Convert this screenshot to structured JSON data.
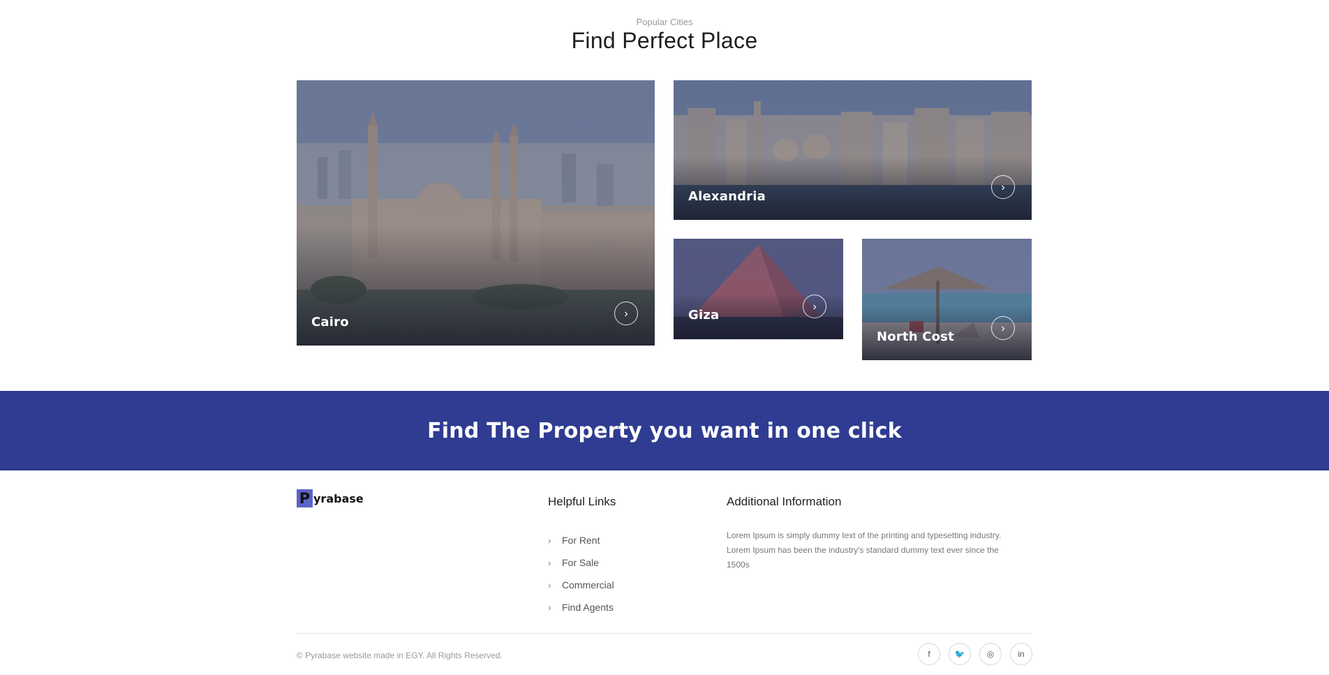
{
  "section": {
    "kicker": "Popular Cities",
    "title": "Find Perfect Place"
  },
  "cities": [
    {
      "name": "Cairo"
    },
    {
      "name": "Alexandria"
    },
    {
      "name": "Giza"
    },
    {
      "name": "North Cost"
    }
  ],
  "cta": {
    "text": "Find The Property you want in one click"
  },
  "footer": {
    "logo_mark": "P",
    "logo_text": "yrabase",
    "helpful_links_title": "Helpful Links",
    "links": [
      "For Rent",
      "For Sale",
      "Commercial",
      "Find Agents"
    ],
    "additional_info_title": "Additional Information",
    "additional_info_text": "Lorem Ipsum is simply dummy text of the printing and typesetting industry. Lorem Ipsum has been the industry's standard dummy text ever since the 1500s",
    "copyright": "© Pyrabase website made in EGY. All Rights Reserved.",
    "socials": [
      {
        "icon": "facebook-icon",
        "glyph": "f"
      },
      {
        "icon": "twitter-icon",
        "glyph": "🐦"
      },
      {
        "icon": "instagram-icon",
        "glyph": "◎"
      },
      {
        "icon": "linkedin-icon",
        "glyph": "in"
      }
    ]
  },
  "colors": {
    "cta_background": "#2f3c91",
    "logo_accent": "#5b64c7"
  },
  "icons": {
    "card_arrow": "chevron-right-icon",
    "link_arrow": "chevron-right-icon"
  }
}
